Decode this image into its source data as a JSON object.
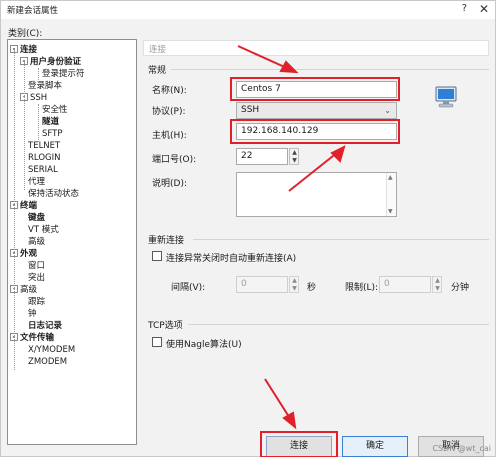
{
  "window": {
    "title": "新建会话属性"
  },
  "category_label": "类别(C):",
  "tree": [
    {
      "label": "连接",
      "bold": true,
      "toggle": "-"
    },
    {
      "label": "用户身份验证",
      "bold": true,
      "toggle": "-"
    },
    {
      "label": "登录提示符"
    },
    {
      "label": "登录脚本"
    },
    {
      "label": "SSH",
      "toggle": "-"
    },
    {
      "label": "安全性"
    },
    {
      "label": "隧道",
      "bold": true
    },
    {
      "label": "SFTP"
    },
    {
      "label": "TELNET"
    },
    {
      "label": "RLOGIN"
    },
    {
      "label": "SERIAL"
    },
    {
      "label": "代理"
    },
    {
      "label": "保持活动状态"
    },
    {
      "label": "终端",
      "bold": true,
      "toggle": "-"
    },
    {
      "label": "键盘",
      "bold": true
    },
    {
      "label": "VT 模式"
    },
    {
      "label": "高级"
    },
    {
      "label": "外观",
      "bold": true,
      "toggle": "-"
    },
    {
      "label": "窗口"
    },
    {
      "label": "突出"
    },
    {
      "label": "高级",
      "toggle": "-"
    },
    {
      "label": "跟踪"
    },
    {
      "label": "钟"
    },
    {
      "label": "日志记录",
      "bold": true
    },
    {
      "label": "文件传输",
      "bold": true,
      "toggle": "-"
    },
    {
      "label": "X/YMODEM"
    },
    {
      "label": "ZMODEM"
    }
  ],
  "section_header": "连接",
  "general": {
    "title": "常规",
    "name_label": "名称(N):",
    "name_value": "Centos 7",
    "protocol_label": "协议(P):",
    "protocol_value": "SSH",
    "host_label": "主机(H):",
    "host_value": "192.168.140.129",
    "port_label": "端口号(O):",
    "port_value": "22",
    "desc_label": "说明(D):"
  },
  "reconnect": {
    "title": "重新连接",
    "checkbox_label": "连接异常关闭时自动重新连接(A)",
    "interval_label": "间隔(V):",
    "interval_value": "0",
    "interval_unit": "秒",
    "limit_label": "限制(L):",
    "limit_value": "0",
    "limit_unit": "分钟"
  },
  "tcp": {
    "title": "TCP选项",
    "nagle_label": "使用Nagle算法(U)"
  },
  "buttons": {
    "connect": "连接",
    "ok": "确定",
    "cancel": "取消"
  },
  "icons": {
    "help": "help-icon",
    "close": "close-icon",
    "computer": "computer-icon"
  },
  "colors": {
    "annotation": "#e0212b",
    "ok_border": "#3c7fd6"
  },
  "watermark": "CSDN @wt_cai"
}
